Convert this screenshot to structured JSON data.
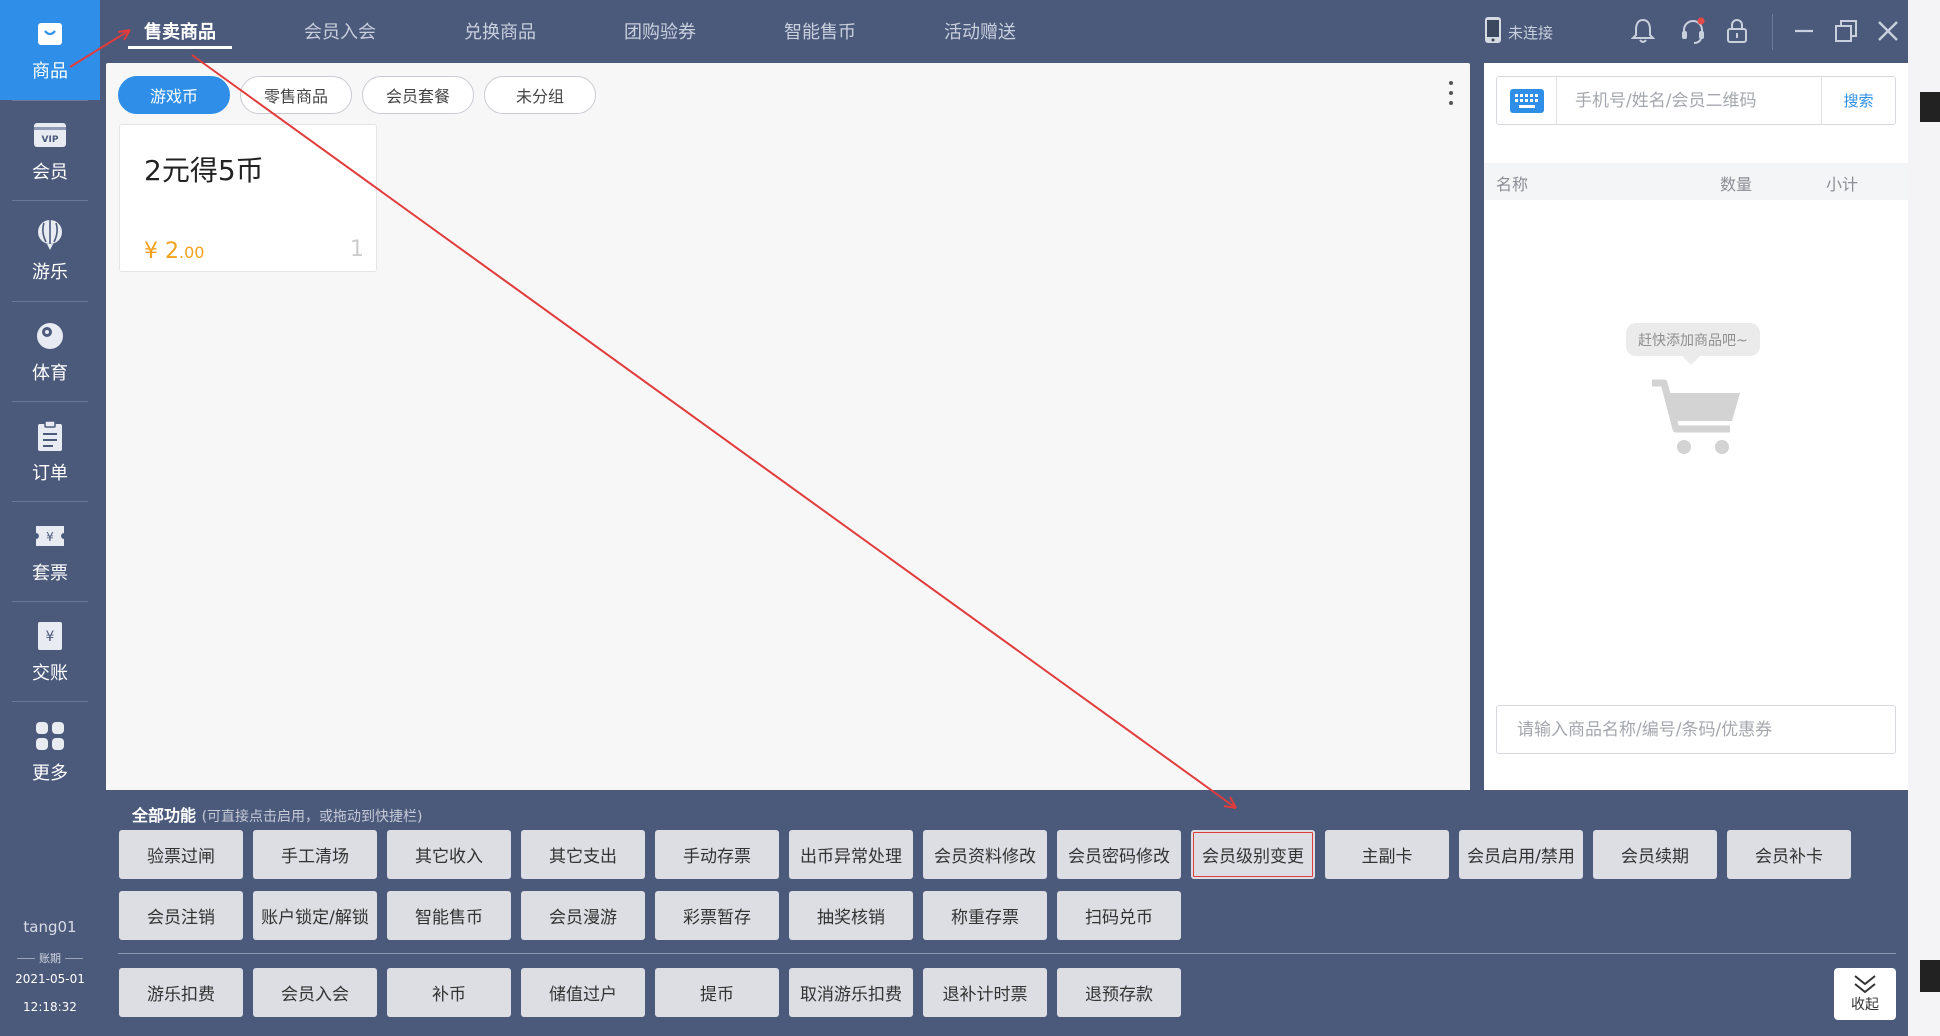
{
  "sidebar": {
    "items": [
      {
        "label": "商品",
        "icon": "shopping-bag-icon"
      },
      {
        "label": "会员",
        "icon": "vip-card-icon"
      },
      {
        "label": "游乐",
        "icon": "balloon-icon"
      },
      {
        "label": "体育",
        "icon": "billiard-ball-icon"
      },
      {
        "label": "订单",
        "icon": "clipboard-icon"
      },
      {
        "label": "套票",
        "icon": "ticket-icon"
      },
      {
        "label": "交账",
        "icon": "yen-bill-icon"
      },
      {
        "label": "更多",
        "icon": "grid-icon"
      }
    ],
    "vip_text": "VIP",
    "user": "tang01",
    "period_label": "账期",
    "period_date": "2021-05-01",
    "period_time": "12:18:32"
  },
  "top_tabs": [
    "售卖商品",
    "会员入会",
    "兑换商品",
    "团购验券",
    "智能售币",
    "活动赠送"
  ],
  "device": {
    "status": "未连接"
  },
  "categories": [
    "游戏币",
    "零售商品",
    "会员套餐",
    "未分组"
  ],
  "product": {
    "name": "2元得5币",
    "price_currency": "¥",
    "price_int": "2",
    "price_dec": ".00",
    "count": "1"
  },
  "cart": {
    "search_placeholder": "手机号/姓名/会员二维码",
    "search_button": "搜索",
    "columns": {
      "name": "名称",
      "qty": "数量",
      "subtotal": "小计"
    },
    "empty_text": "赶快添加商品吧~",
    "product_search_placeholder": "请输入商品名称/编号/条码/优惠券"
  },
  "functions": {
    "title": "全部功能",
    "hint": "(可直接点击启用，或拖动到快捷栏)",
    "row1": [
      "验票过闸",
      "手工清场",
      "其它收入",
      "其它支出",
      "手动存票",
      "出币异常处理",
      "会员资料修改",
      "会员密码修改",
      "会员级别变更",
      "主副卡",
      "会员启用/禁用",
      "会员续期",
      "会员补卡"
    ],
    "row2": [
      "会员注销",
      "账户锁定/解锁",
      "智能售币",
      "会员漫游",
      "彩票暂存",
      "抽奖核销",
      "称重存票",
      "扫码兑币"
    ],
    "shortcuts": [
      "游乐扣费",
      "会员入会",
      "补币",
      "储值过户",
      "提币",
      "取消游乐扣费",
      "退补计时票",
      "退预存款"
    ],
    "collapse_label": "收起"
  },
  "colors": {
    "accent": "#2f8fe8",
    "sidebar": "#4b5a7b",
    "price": "#f3a11c",
    "annotation": "#e23b3b"
  }
}
